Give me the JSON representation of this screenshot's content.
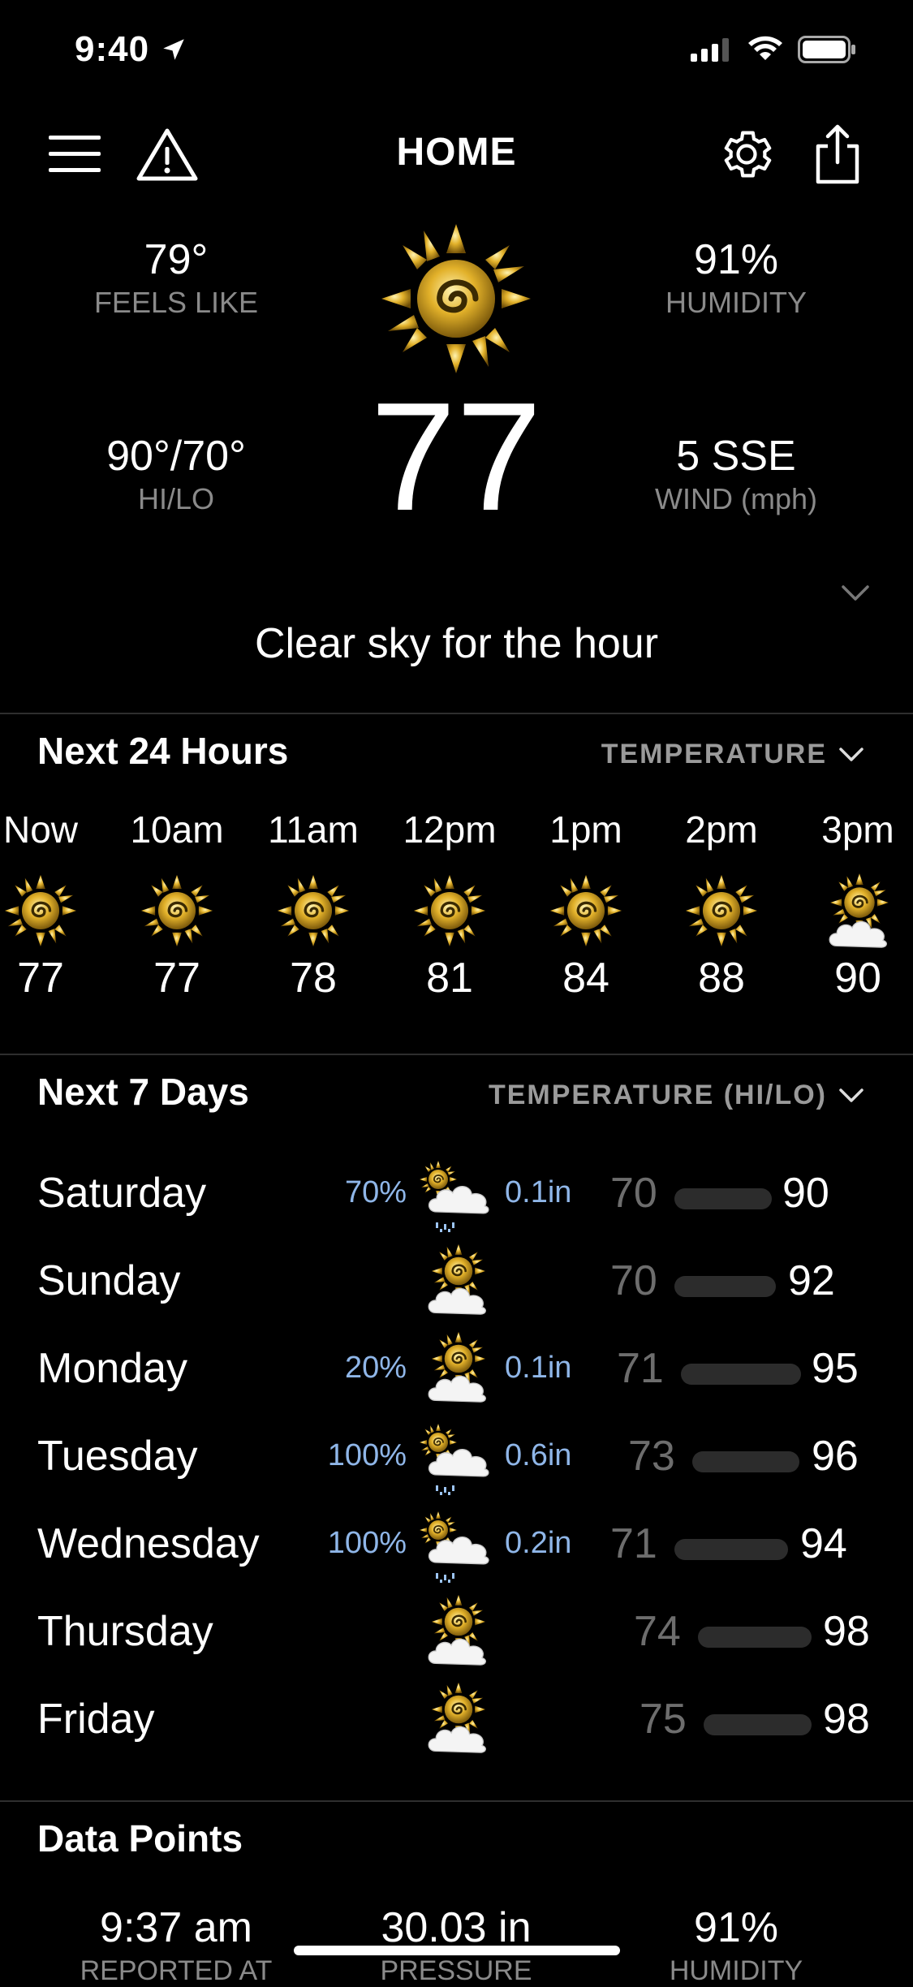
{
  "status": {
    "time": "9:40"
  },
  "nav": {
    "title": "HOME"
  },
  "current": {
    "feels_like": {
      "value": "79°",
      "label": "FEELS LIKE"
    },
    "humidity": {
      "value": "91%",
      "label": "HUMIDITY"
    },
    "hilo": {
      "value": "90°/70°",
      "label": "HI/LO"
    },
    "wind": {
      "value": "5 SSE",
      "label": "WIND (mph)"
    },
    "temp": "77",
    "icon": "sun-icon",
    "summary": "Clear sky for the hour"
  },
  "hourly": {
    "title": "Next 24 Hours",
    "selector": "TEMPERATURE",
    "items": [
      {
        "time": "Now",
        "temp": "77",
        "icon": "sun-icon"
      },
      {
        "time": "10am",
        "temp": "77",
        "icon": "sun-icon"
      },
      {
        "time": "11am",
        "temp": "78",
        "icon": "sun-icon"
      },
      {
        "time": "12pm",
        "temp": "81",
        "icon": "sun-icon"
      },
      {
        "time": "1pm",
        "temp": "84",
        "icon": "sun-icon"
      },
      {
        "time": "2pm",
        "temp": "88",
        "icon": "sun-icon"
      },
      {
        "time": "3pm",
        "temp": "90",
        "icon": "partly-cloudy-icon"
      }
    ]
  },
  "daily": {
    "title": "Next 7 Days",
    "selector": "TEMPERATURE (HI/LO)",
    "items": [
      {
        "day": "Saturday",
        "pop": "70%",
        "amount": "0.1in",
        "lo": "70",
        "hi": "90",
        "icon": "rain-icon"
      },
      {
        "day": "Sunday",
        "pop": "",
        "amount": "",
        "lo": "70",
        "hi": "92",
        "icon": "partly-cloudy-icon"
      },
      {
        "day": "Monday",
        "pop": "20%",
        "amount": "0.1in",
        "lo": "71",
        "hi": "95",
        "icon": "partly-cloudy-icon"
      },
      {
        "day": "Tuesday",
        "pop": "100%",
        "amount": "0.6in",
        "lo": "73",
        "hi": "96",
        "icon": "rain-icon"
      },
      {
        "day": "Wednesday",
        "pop": "100%",
        "amount": "0.2in",
        "lo": "71",
        "hi": "94",
        "icon": "rain-icon"
      },
      {
        "day": "Thursday",
        "pop": "",
        "amount": "",
        "lo": "74",
        "hi": "98",
        "icon": "partly-cloudy-icon"
      },
      {
        "day": "Friday",
        "pop": "",
        "amount": "",
        "lo": "75",
        "hi": "98",
        "icon": "partly-cloudy-icon"
      }
    ]
  },
  "data_points": {
    "title": "Data Points",
    "items": [
      {
        "value": "9:37 am",
        "label": "REPORTED AT"
      },
      {
        "value": "30.03 in",
        "label": "PRESSURE"
      },
      {
        "value": "91%",
        "label": "HUMIDITY"
      }
    ]
  },
  "colors": {
    "background": "#000000",
    "accent_blue": "#8fb6e8",
    "sun_gold": "#d4a514"
  }
}
